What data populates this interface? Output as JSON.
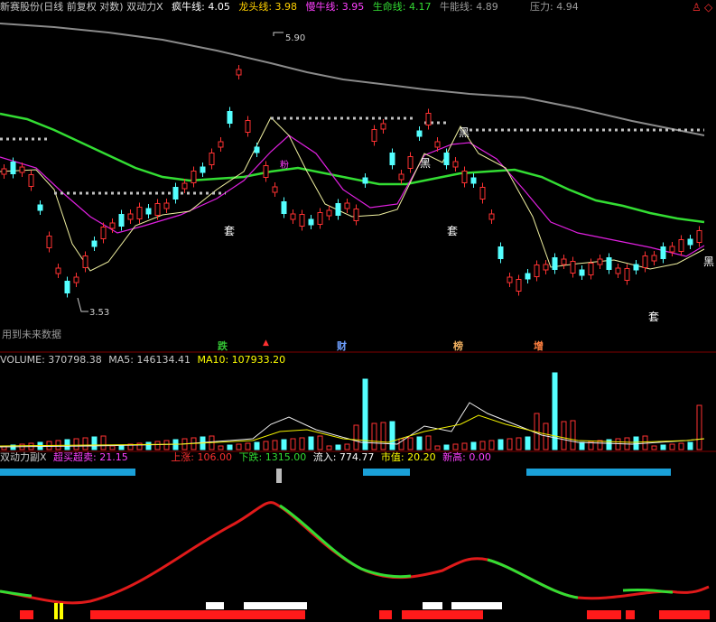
{
  "header": {
    "title": "新赛股份(日线 前复权 对数) 双动力X",
    "crazy_bull_label": "疯牛线:",
    "crazy_bull_value": "4.05",
    "dragon_head_label": "龙头线:",
    "dragon_head_value": "3.98",
    "slow_bull_label": "慢牛线:",
    "slow_bull_value": "3.95",
    "life_line_label": "生命线:",
    "life_line_value": "4.17",
    "bull_power_label": "牛能线:",
    "bull_power_value": "4.89",
    "pressure_label": "压力:",
    "pressure_value": "4.94"
  },
  "main_chart": {
    "high_label": "5.90",
    "low_label": "3.53",
    "notice": "用到未来数据",
    "annotations": [
      "套",
      "套",
      "套",
      "黑",
      "黑",
      "黑",
      "粉"
    ],
    "bottom_markers": [
      {
        "text": "跌",
        "color": "#34c334"
      },
      {
        "text": "财",
        "color": "#6fa0ff"
      },
      {
        "text": "榜",
        "color": "#f0b060"
      },
      {
        "text": "增",
        "color": "#ff8040"
      }
    ]
  },
  "volume": {
    "label": "VOLUME: 370798.38",
    "ma5": "MA5: 146134.41",
    "ma10": "MA10: 107933.20"
  },
  "indicator": {
    "title": "双动力副X",
    "oversold_label": "超买超卖:",
    "oversold_value": "21.15",
    "up_label": "上涨:",
    "up_value": "106.00",
    "down_label": "下跌:",
    "down_value": "1315.00",
    "inflow_label": "流入:",
    "inflow_value": "774.77",
    "market_cap_label": "市值:",
    "market_cap_value": "20.20",
    "new_high_label": "新高:",
    "new_high_value": "0.00"
  },
  "colors": {
    "background": "#000000",
    "up": "#ff3232",
    "down": "#54ffff",
    "life_line": "#33dd33",
    "pressure_line": "#888888",
    "magenta": "#ff00ff",
    "yellow": "#ffff00"
  },
  "icons": [
    "bell-icon",
    "diamond-icon"
  ]
}
